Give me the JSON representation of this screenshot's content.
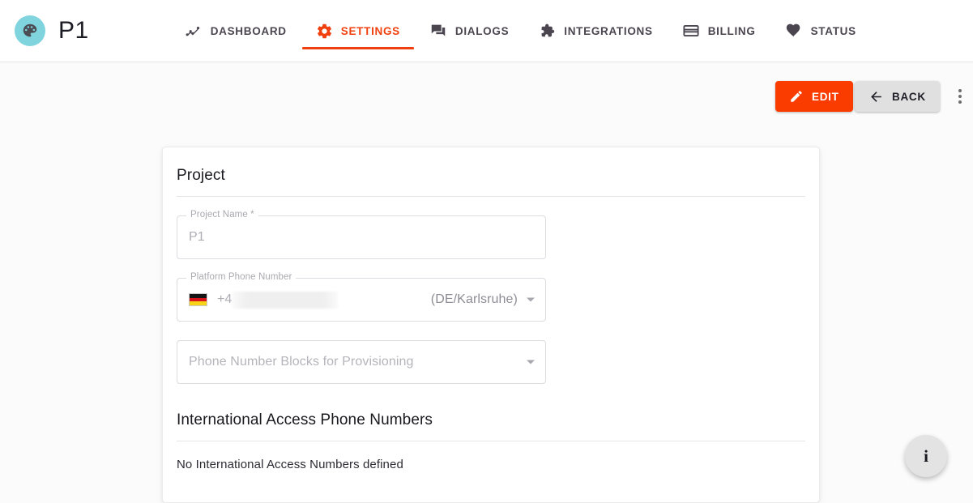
{
  "brand": {
    "title": "P1",
    "logo_icon": "palette-icon",
    "logo_color": "#7fd4dd"
  },
  "nav": {
    "active_color": "#f0400f",
    "items": [
      {
        "label": "DASHBOARD",
        "icon": "line-chart-icon",
        "active": false
      },
      {
        "label": "SETTINGS",
        "icon": "gear-icon",
        "active": true
      },
      {
        "label": "DIALOGS",
        "icon": "chat-bubbles-icon",
        "active": false
      },
      {
        "label": "INTEGRATIONS",
        "icon": "puzzle-piece-icon",
        "active": false
      },
      {
        "label": "BILLING",
        "icon": "credit-card-icon",
        "active": false
      },
      {
        "label": "STATUS",
        "icon": "heart-icon",
        "active": false
      }
    ]
  },
  "actionbar": {
    "edit_label": "EDIT",
    "edit_icon": "pencil-icon",
    "edit_color": "#fa3c00",
    "back_label": "BACK",
    "back_icon": "arrow-left-icon",
    "back_color": "#e0e0e0",
    "overflow_icon": "more-vertical-icon"
  },
  "card": {
    "project_section": {
      "title": "Project",
      "project_name": {
        "legend": "Project Name *",
        "value": "P1"
      },
      "platform_phone_number": {
        "legend": "Platform Phone Number",
        "flag_icon": "flag-de-icon",
        "prefix": "+4",
        "redacted": true,
        "region": "(DE/Karlsruhe)",
        "caret_icon": "chevron-down-icon"
      },
      "phone_number_blocks": {
        "placeholder": "Phone Number Blocks for Provisioning",
        "value": "",
        "caret_icon": "chevron-down-icon"
      }
    },
    "international_section": {
      "title": "International Access Phone Numbers",
      "empty_message": "No International Access Numbers defined"
    }
  },
  "fab": {
    "icon": "info-icon",
    "label": "i"
  }
}
